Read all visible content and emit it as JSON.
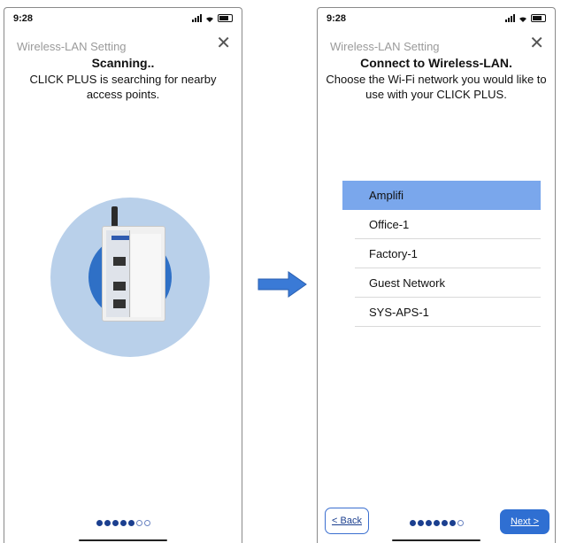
{
  "left_screen": {
    "status_time": "9:28",
    "header_title": "Wireless-LAN Setting",
    "close_glyph": "✕",
    "heading": "Scanning..",
    "description": "CLICK PLUS is searching for nearby access points.",
    "page_indicator": {
      "total": 7,
      "active": 5
    }
  },
  "right_screen": {
    "status_time": "9:28",
    "header_title": "Wireless-LAN Setting",
    "close_glyph": "✕",
    "heading": "Connect to Wireless-LAN.",
    "description": "Choose the Wi-Fi network you would like to use with your CLICK PLUS.",
    "networks": [
      "Amplifi",
      "Office-1",
      "Factory-1",
      "Guest Network",
      "SYS-APS-1"
    ],
    "selected_network": "Amplifi",
    "back_label": "< Back",
    "next_label": "Next >",
    "page_indicator": {
      "total": 7,
      "active": 6
    }
  },
  "icons": {
    "close": "close-icon",
    "signal": "cellular-signal-icon",
    "wifi": "wifi-icon",
    "battery": "battery-icon",
    "location": "location-arrow-icon",
    "arrow": "right-arrow-icon"
  },
  "colors": {
    "selected_row": "#7aa7ec",
    "accent": "#2f6fd2",
    "dot_active": "#1b3f8f",
    "ring_outer": "#b9d0ea",
    "ring_inner": "#2f70c6",
    "arrow": "#3a7ad6"
  }
}
